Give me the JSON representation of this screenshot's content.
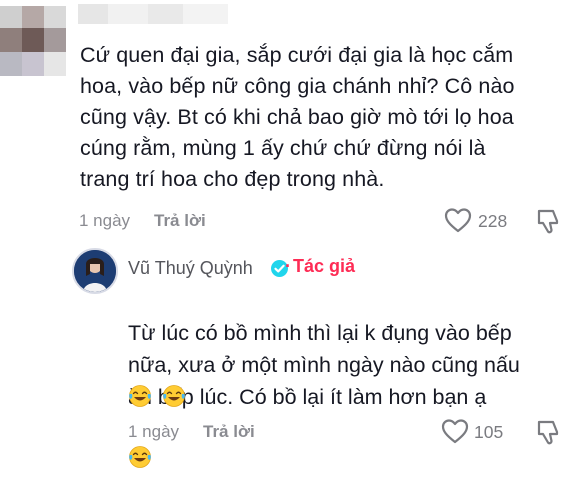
{
  "comment": {
    "text": "Cứ quen đại gia, sắp cưới đại gia là học cắm\nhoa, vào bếp nữ công gia chánh nhỉ? Cô nào\ncũng vậy. Bt có khi chả bao giờ mò tới lọ hoa\ncúng rằm, mùng 1 ấy chứ chứ đừng nói là\ntrang trí hoa cho đẹp trong nhà.",
    "time": "1 ngày",
    "reply_label": "Trả lời",
    "likes": "228"
  },
  "reply": {
    "author": "Vũ Thuý Quỳnh",
    "author_tag": "Tác giả",
    "text": "Từ lúc có bồ mình thì lại k đụng vào bếp\nnữa, xưa ở một mình ngày nào cũng nấu\năn bếp lúc. Có bồ lại ít làm hơn bạn ạ",
    "time": "1 ngày",
    "reply_label": "Trả lời",
    "likes": "105"
  },
  "icons": {
    "like": "heart-outline-icon",
    "dislike": "thumb-down-outline-icon",
    "verified": "verified-check-icon",
    "emoji": "tears-of-joy-emoji"
  },
  "colors": {
    "text": "#161823",
    "muted": "#8a8b91",
    "author_tag": "#fe2c55",
    "verified": "#20d5ec"
  }
}
